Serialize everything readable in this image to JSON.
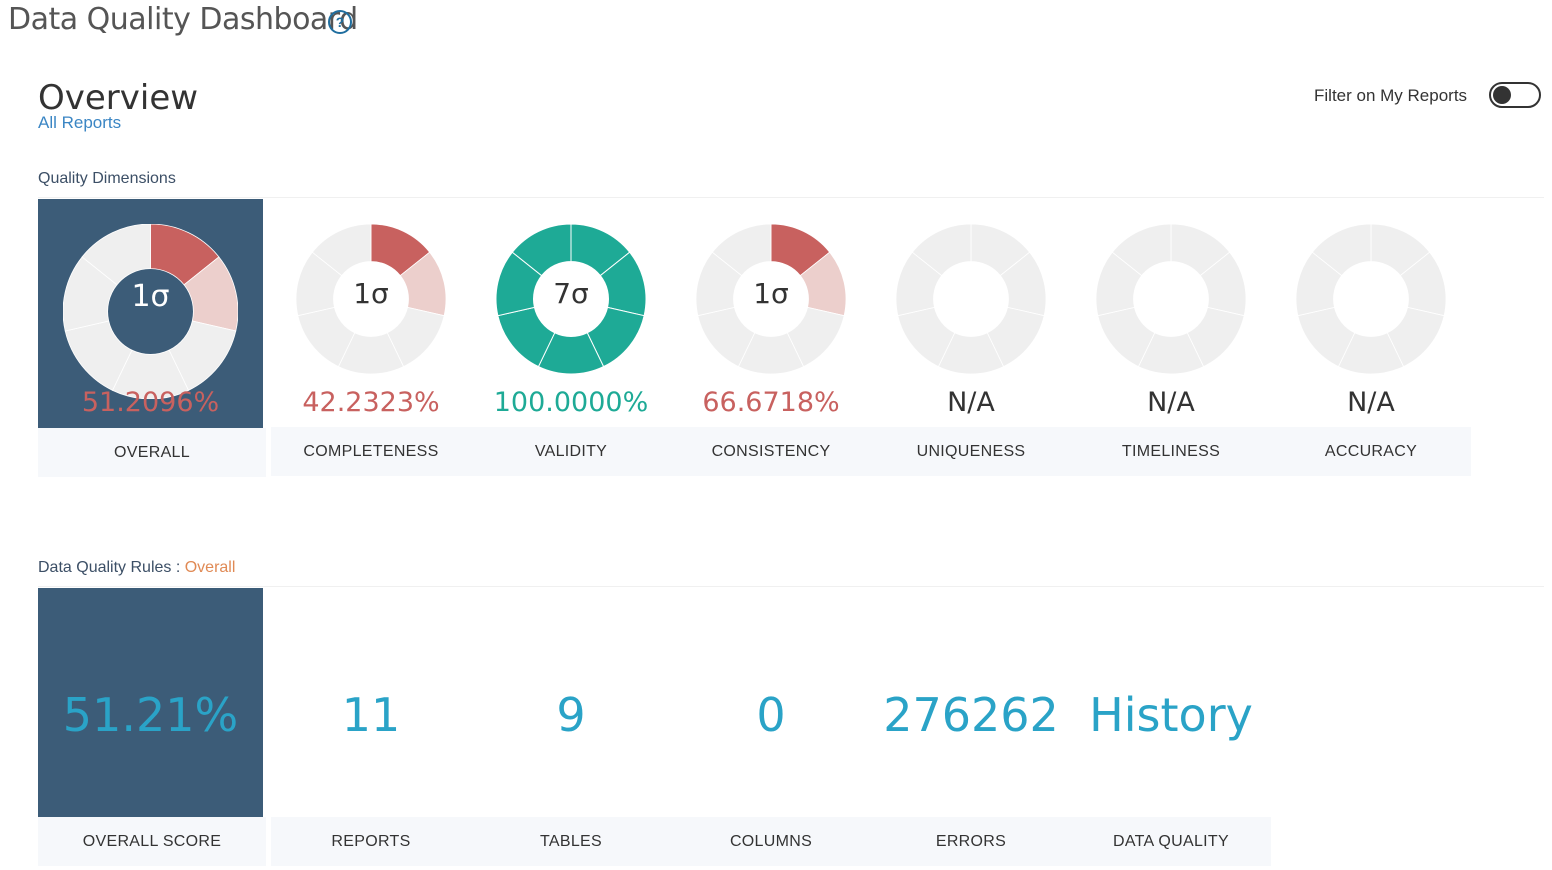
{
  "header": {
    "title": "Data Quality Dashboard",
    "help_icon": "question-circle-icon"
  },
  "overview": {
    "title": "Overview",
    "scope_link": "All Reports"
  },
  "filter": {
    "label": "Filter on My Reports",
    "enabled": false
  },
  "colors": {
    "navy": "#3c5c78",
    "red": "#c8615f",
    "light_red": "#eccfcc",
    "teal": "#1eaa96",
    "grey": "#efefef",
    "blue": "#2aa3c7",
    "accent": "#e08a55"
  },
  "dimensions": {
    "section_label": "Quality Dimensions",
    "items": [
      {
        "key": "overall",
        "label": "OVERALL",
        "sigma": "1σ",
        "score": "51.2096%",
        "value": 0.512096,
        "state": "bad"
      },
      {
        "key": "completeness",
        "label": "COMPLETENESS",
        "sigma": "1σ",
        "score": "42.2323%",
        "value": 0.422323,
        "state": "bad"
      },
      {
        "key": "validity",
        "label": "VALIDITY",
        "sigma": "7σ",
        "score": "100.0000%",
        "value": 1.0,
        "state": "good"
      },
      {
        "key": "consistency",
        "label": "CONSISTENCY",
        "sigma": "1σ",
        "score": "66.6718%",
        "value": 0.666718,
        "state": "bad"
      },
      {
        "key": "uniqueness",
        "label": "UNIQUENESS",
        "sigma": "",
        "score": "N/A",
        "value": null,
        "state": "na"
      },
      {
        "key": "timeliness",
        "label": "TIMELINESS",
        "sigma": "",
        "score": "N/A",
        "value": null,
        "state": "na"
      },
      {
        "key": "accuracy",
        "label": "ACCURACY",
        "sigma": "",
        "score": "N/A",
        "value": null,
        "state": "na"
      }
    ]
  },
  "rules": {
    "section_label": "Data Quality Rules",
    "separator": " : ",
    "scope": "Overall",
    "stats": [
      {
        "key": "overall_score",
        "label": "OVERALL SCORE",
        "value": "51.21%"
      },
      {
        "key": "reports",
        "label": "REPORTS",
        "value": "11"
      },
      {
        "key": "tables",
        "label": "TABLES",
        "value": "9"
      },
      {
        "key": "columns",
        "label": "COLUMNS",
        "value": "0"
      },
      {
        "key": "errors",
        "label": "ERRORS",
        "value": "276262"
      },
      {
        "key": "data_quality",
        "label": "DATA QUALITY",
        "value": "History"
      }
    ]
  }
}
